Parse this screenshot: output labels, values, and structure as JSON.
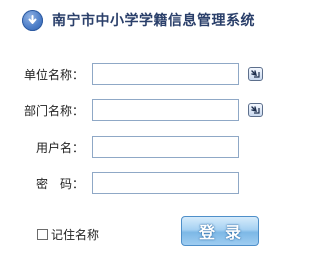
{
  "header": {
    "title": "南宁市中小学学籍信息管理系统",
    "icon": "download-arrow-icon"
  },
  "form": {
    "unit": {
      "label": "单位名称：",
      "value": "",
      "picker_icon": "select-arrow-icon"
    },
    "department": {
      "label": "部门名称：",
      "value": "",
      "picker_icon": "select-arrow-icon"
    },
    "username": {
      "label": "用户名：",
      "value": ""
    },
    "password": {
      "label": "密　码：",
      "value": ""
    }
  },
  "remember": {
    "label": "记住名称",
    "checked": false
  },
  "login_button": {
    "label": "登录"
  },
  "colors": {
    "title": "#2a3f6a",
    "field_border": "#8fa8c6",
    "button": "#7db8e6"
  }
}
